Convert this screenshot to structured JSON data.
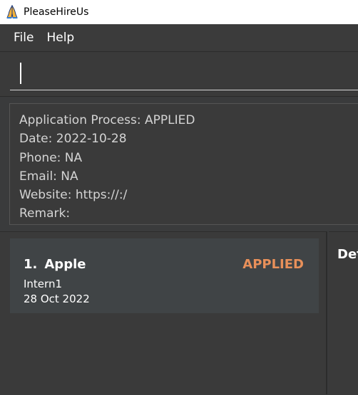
{
  "window": {
    "title": "PleaseHireUs",
    "icon": "praying-hands-icon"
  },
  "menu": {
    "items": [
      "File",
      "Help"
    ]
  },
  "command_box": {
    "value": "",
    "placeholder": ""
  },
  "result_display": {
    "lines": [
      "Application Process: APPLIED",
      "Date: 2022-10-28",
      "Phone: NA",
      "Email: NA",
      "Website: https://:/",
      "Remark:"
    ]
  },
  "internship_list": {
    "cards": [
      {
        "index": "1.",
        "company": "Apple",
        "status": "APPLIED",
        "position": "Intern1",
        "date": "28 Oct 2022",
        "status_color": "#e8905a"
      }
    ]
  },
  "detail_panel": {
    "title": "Det"
  }
}
